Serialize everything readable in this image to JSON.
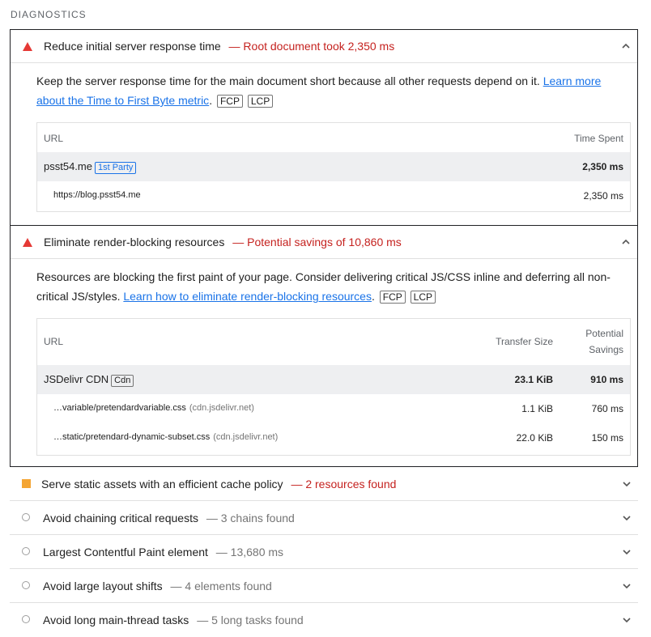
{
  "section_title": "DIAGNOSTICS",
  "audits": [
    {
      "title": "Reduce initial server response time",
      "display": "— Root document took 2,350 ms",
      "desc_text": "Keep the server response time for the main document short because all other requests depend on it. ",
      "desc_link": "Learn more about the Time to First Byte metric",
      "tags": [
        "FCP",
        "LCP"
      ],
      "table": {
        "headers": [
          "URL",
          "Time Spent"
        ],
        "group": {
          "name": "psst54.me",
          "badge": "1st Party",
          "value": "2,350 ms"
        },
        "rows": [
          {
            "url": "https://blog.psst54.me",
            "value": "2,350 ms"
          }
        ]
      }
    },
    {
      "title": "Eliminate render-blocking resources",
      "display": "— Potential savings of 10,860 ms",
      "desc_text": "Resources are blocking the first paint of your page. Consider delivering critical JS/CSS inline and deferring all non-critical JS/styles. ",
      "desc_link": "Learn how to eliminate render-blocking resources",
      "tags": [
        "FCP",
        "LCP"
      ],
      "table": {
        "headers": [
          "URL",
          "Transfer Size",
          "Potential",
          "Savings"
        ],
        "group": {
          "name": "JSDelivr CDN",
          "badge": "Cdn",
          "size": "23.1 KiB",
          "savings": "910 ms"
        },
        "rows": [
          {
            "url": "…variable/pretendardvariable.css",
            "source": "(cdn.jsdelivr.net)",
            "size": "1.1 KiB",
            "savings": "760 ms"
          },
          {
            "url": "…static/pretendard-dynamic-subset.css",
            "source": "(cdn.jsdelivr.net)",
            "size": "22.0 KiB",
            "savings": "150 ms"
          }
        ]
      }
    }
  ],
  "collapsed": [
    {
      "title": "Serve static assets with an efficient cache policy",
      "display": "— 2 resources found",
      "severity": "warn"
    },
    {
      "title": "Avoid chaining critical requests",
      "display": "— 3 chains found",
      "severity": "info"
    },
    {
      "title": "Largest Contentful Paint element",
      "display": "— 13,680 ms",
      "severity": "info"
    },
    {
      "title": "Avoid large layout shifts",
      "display": "— 4 elements found",
      "severity": "info"
    },
    {
      "title": "Avoid long main-thread tasks",
      "display": "— 5 long tasks found",
      "severity": "info"
    }
  ],
  "colors": {
    "fail": "#e53935",
    "warn": "#f4a534",
    "link": "#1a73e8",
    "savings_text": "#c5221f"
  }
}
